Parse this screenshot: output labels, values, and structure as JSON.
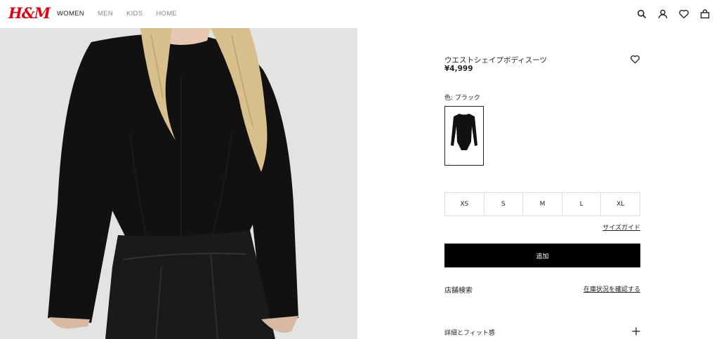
{
  "brand": {
    "logo": "H&M",
    "logo_color": "#e50010"
  },
  "nav": {
    "items": [
      {
        "label": "WOMEN",
        "active": true
      },
      {
        "label": "MEN",
        "active": false
      },
      {
        "label": "KIDS",
        "active": false
      },
      {
        "label": "HOME",
        "active": false
      }
    ]
  },
  "header_icons": [
    "search-icon",
    "account-icon",
    "favorites-icon",
    "cart-icon"
  ],
  "product": {
    "name": "ウエストシェイプボディスーツ",
    "price": "¥4,999",
    "color_label": "色: ブラック",
    "sizes": [
      "XS",
      "S",
      "M",
      "L",
      "XL"
    ],
    "size_guide": "サイズガイド",
    "add_button": "追加",
    "store_search_label": "店舗検索",
    "store_search_link": "在庫状況を確認する",
    "details_label": "詳細とフィット感"
  },
  "colors": {
    "accent": "#e50010",
    "button_bg": "#000000",
    "image_bg": "#e3e3e1"
  }
}
